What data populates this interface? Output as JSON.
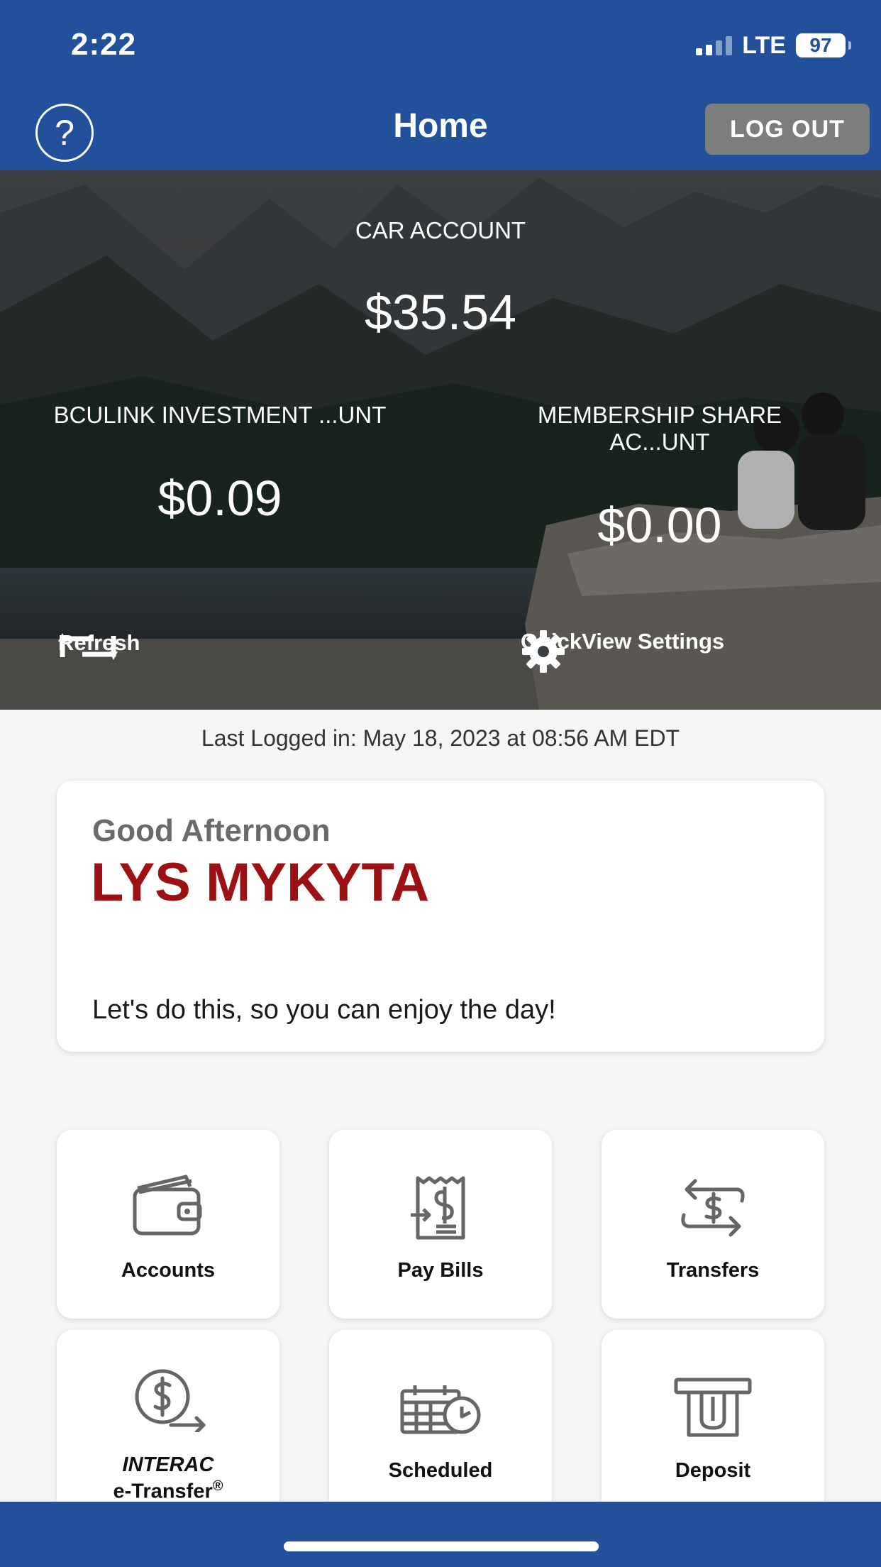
{
  "status": {
    "time": "2:22",
    "network": "LTE",
    "battery": "97"
  },
  "header": {
    "title": "Home",
    "logout_label": "LOG OUT",
    "help_icon": "?"
  },
  "quickview": {
    "primary": {
      "name": "CAR ACCOUNT",
      "balance": "$35.54"
    },
    "left": {
      "name": "BCULINK INVESTMENT ...UNT",
      "balance": "$0.09"
    },
    "right": {
      "name_line1": "MEMBERSHIP SHARE",
      "name_line2": "AC...UNT",
      "balance": "$0.00"
    },
    "refresh_label": "Refresh",
    "settings_label": "QuickView Settings"
  },
  "last_login": "Last Logged in: May 18, 2023 at 08:56 AM  EDT",
  "greeting": {
    "salutation": "Good Afternoon",
    "name": "LYS MYKYTA",
    "message": "Let's do this, so you can enjoy the day!"
  },
  "tiles": {
    "accounts": "Accounts",
    "pay_bills": "Pay Bills",
    "transfers": "Transfers",
    "interac_line1": "INTERAC",
    "interac_line2": "e-Transfer",
    "interac_mark": "®",
    "scheduled": "Scheduled",
    "deposit": "Deposit"
  },
  "colors": {
    "brand_blue": "#22509a",
    "name_red": "#9c1214",
    "logout_gray": "#7d7d7d"
  }
}
